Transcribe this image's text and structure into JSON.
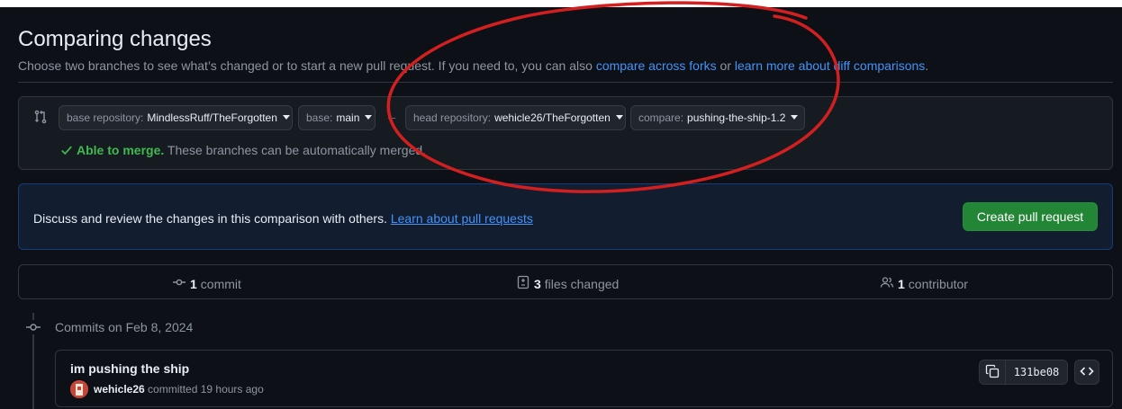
{
  "header": {
    "title": "Comparing changes",
    "subtitle_text": "Choose two branches to see what’s changed or to start a new pull request. If you need to, you can also ",
    "link_forks": "compare across forks",
    "subtitle_or": " or ",
    "link_diff": "learn more about diff comparisons",
    "subtitle_end": "."
  },
  "range": {
    "base_repo_label": "base repository:",
    "base_repo_value": "MindlessRuff/TheForgotten",
    "base_label": "base:",
    "base_value": "main",
    "arrow": "←",
    "head_repo_label": "head repository:",
    "head_repo_value": "wehicle26/TheForgotten",
    "compare_label": "compare:",
    "compare_value": "pushing-the-ship-1.2",
    "merge_status": "Able to merge.",
    "merge_detail": " These branches can be automatically merged."
  },
  "discuss": {
    "text": "Discuss and review the changes in this comparison with others. ",
    "link": "Learn about pull requests",
    "button": "Create pull request"
  },
  "stats": {
    "commits_count": "1",
    "commits_label": "commit",
    "files_count": "3",
    "files_label": "files changed",
    "contributors_count": "1",
    "contributors_label": "contributor"
  },
  "timeline": {
    "date_heading": "Commits on Feb 8, 2024"
  },
  "commit": {
    "message": "im pushing the ship",
    "author": "wehicle26",
    "meta": " committed 19 hours ago",
    "sha": "131be08"
  },
  "icons": {
    "compare": "git-compare-icon",
    "check": "check-icon",
    "commit": "git-commit-icon",
    "diff": "file-diff-icon",
    "people": "people-icon",
    "copy": "copy-icon",
    "code": "code-icon"
  },
  "colors": {
    "accent_link": "#4493f8",
    "success": "#3fb950",
    "button_green": "#238636",
    "annotation_red": "#d21f1f"
  }
}
